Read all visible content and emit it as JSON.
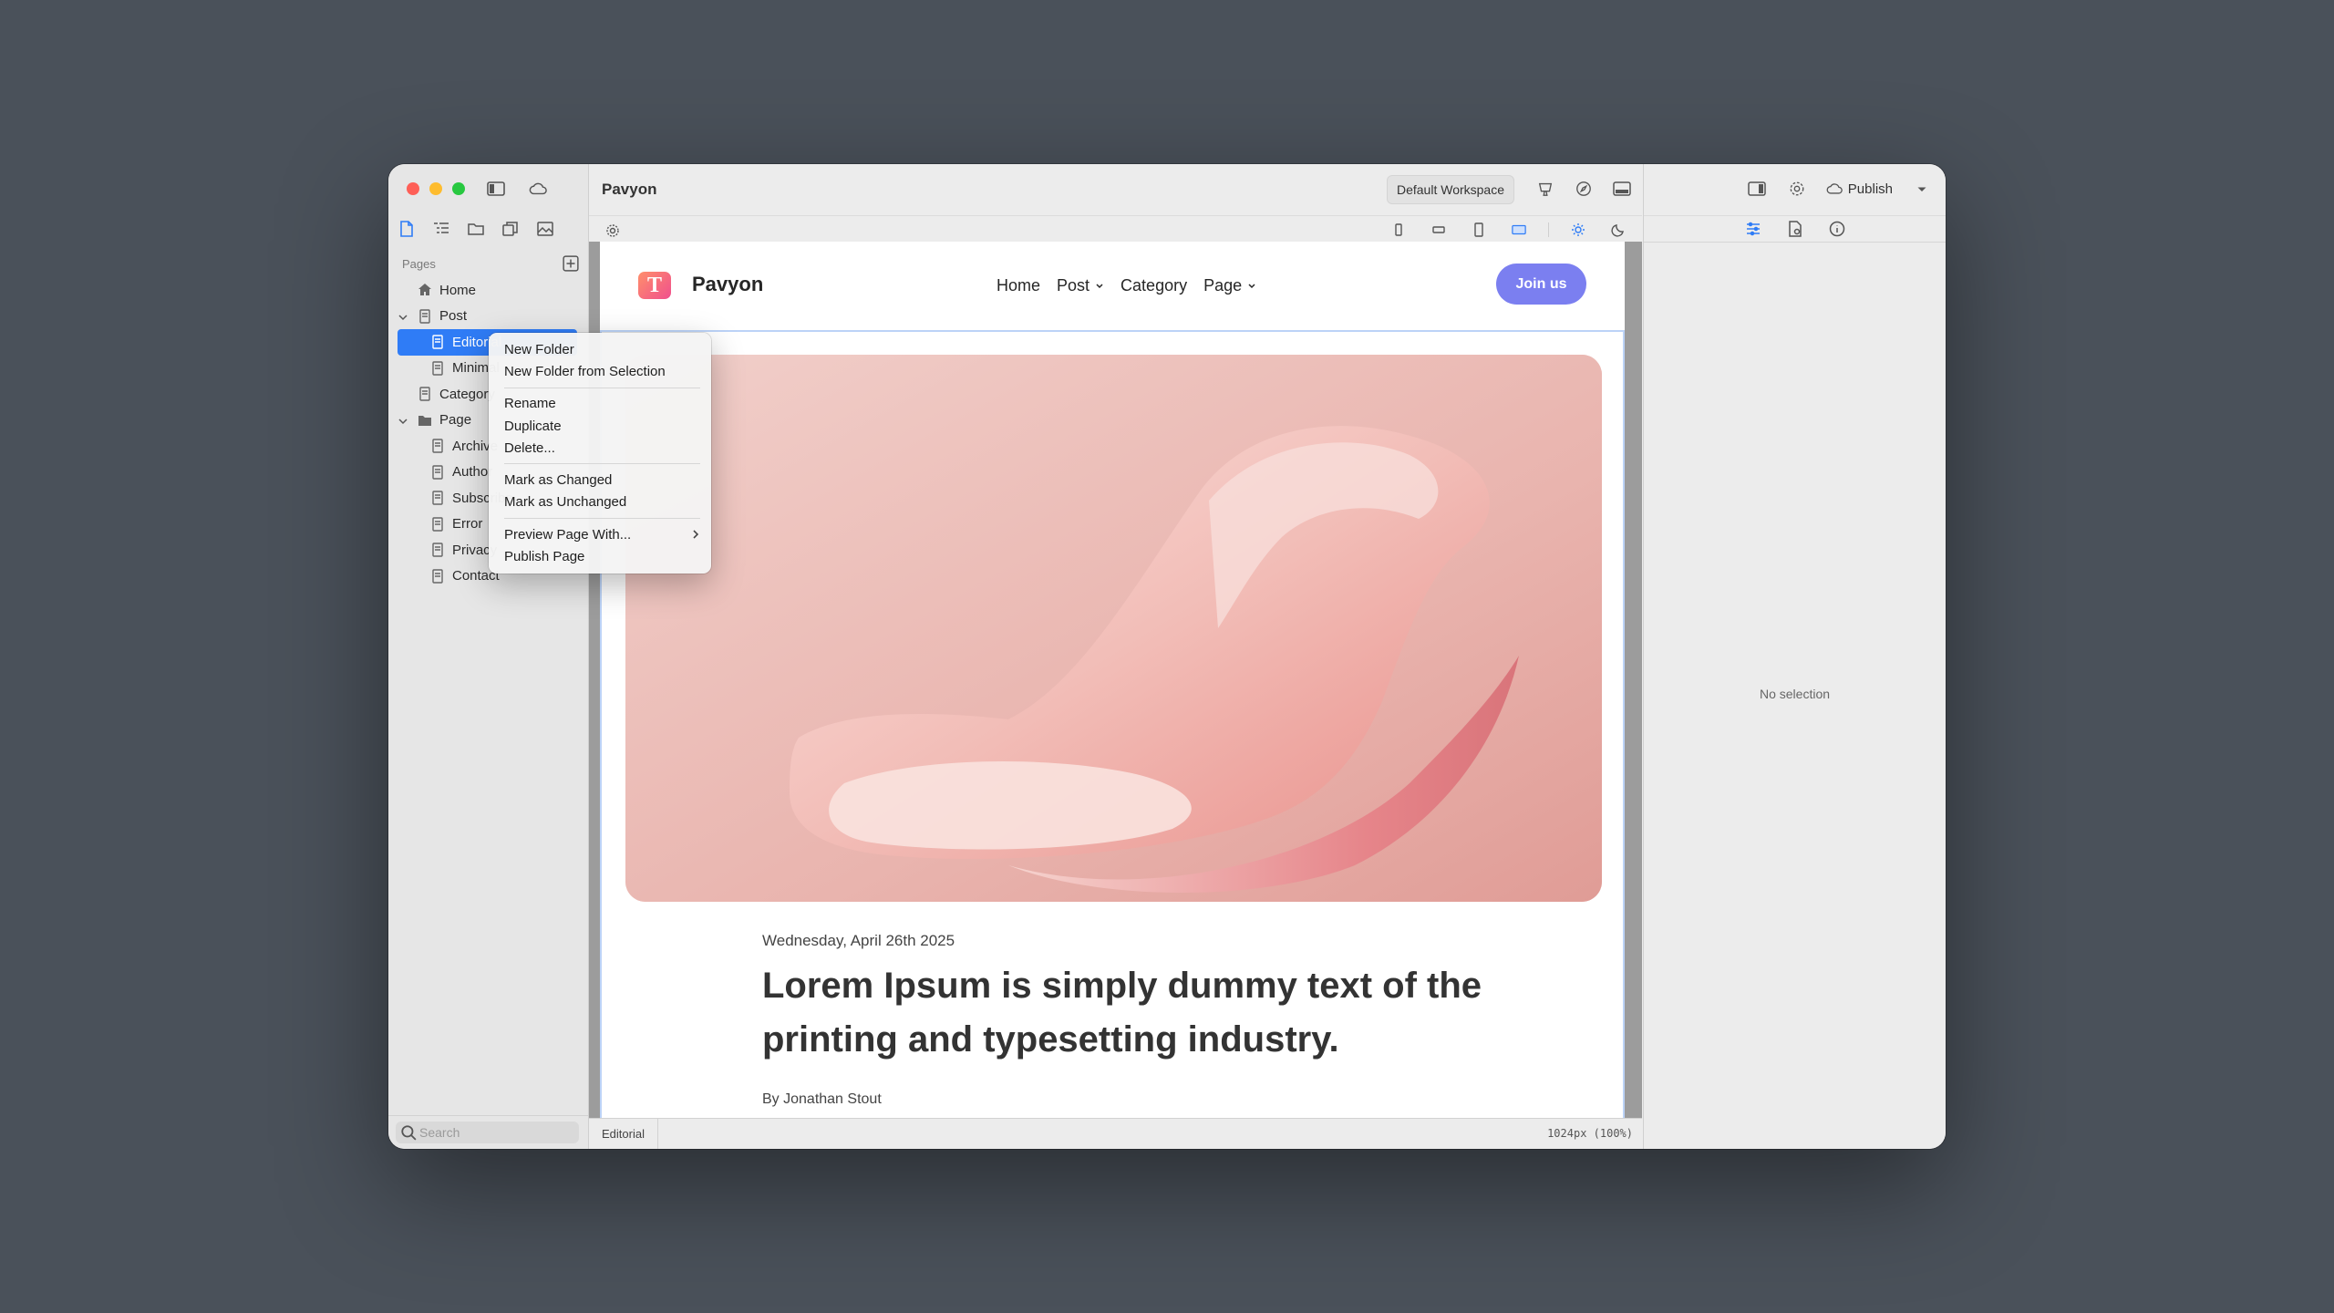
{
  "app": {
    "title": "Pavyon"
  },
  "toolbar": {
    "workspace": "Default Workspace"
  },
  "inspector": {
    "publish_label": "Publish",
    "empty_text": "No selection"
  },
  "sidebar": {
    "section_title": "Pages",
    "search_placeholder": "Search",
    "pages": [
      {
        "label": "Home"
      },
      {
        "label": "Post"
      },
      {
        "label": "Editorial"
      },
      {
        "label": "Minimal"
      },
      {
        "label": "Category"
      },
      {
        "label": "Page"
      },
      {
        "label": "Archive"
      },
      {
        "label": "Author"
      },
      {
        "label": "Subscribe"
      },
      {
        "label": "Error"
      },
      {
        "label": "Privacy"
      },
      {
        "label": "Contact"
      }
    ]
  },
  "context_menu": {
    "items": [
      {
        "label": "New Folder"
      },
      {
        "label": "New Folder from Selection"
      },
      {
        "label": "Rename"
      },
      {
        "label": "Duplicate"
      },
      {
        "label": "Delete..."
      },
      {
        "label": "Mark as Changed"
      },
      {
        "label": "Mark as Unchanged"
      },
      {
        "label": "Preview Page With..."
      },
      {
        "label": "Publish Page"
      }
    ]
  },
  "site": {
    "logo_letter": "T",
    "brand": "Pavyon",
    "nav": [
      {
        "label": "Home"
      },
      {
        "label": "Post"
      },
      {
        "label": "Category"
      },
      {
        "label": "Page"
      }
    ],
    "join_label": "Join us",
    "date": "Wednesday, April 26th 2025",
    "headline": "Lorem Ipsum is simply dummy text of the printing and typesetting industry.",
    "byline": "By Jonathan Stout"
  },
  "statusbar": {
    "tab": "Editorial",
    "size": "1024px (100%)"
  },
  "colors": {
    "accent": "#2f7cf6",
    "join_button": "#7b7ff0",
    "hero": "#e8b2ad"
  }
}
